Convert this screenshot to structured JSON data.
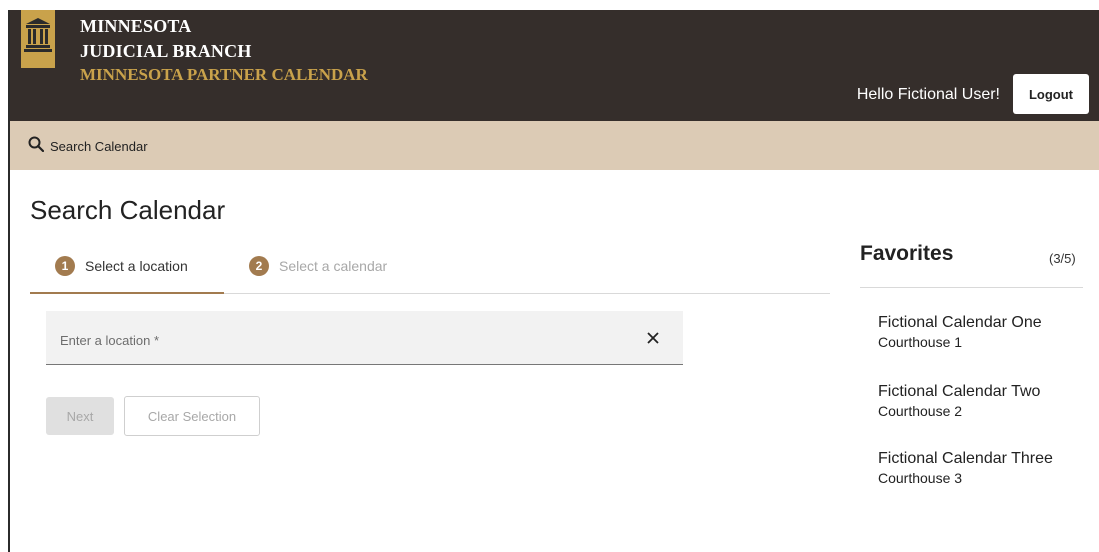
{
  "header": {
    "brand_line1": "MINNESOTA",
    "brand_line2": "JUDICIAL BRANCH",
    "brand_line3": "MINNESOTA PARTNER CALENDAR",
    "greeting": "Hello Fictional User!",
    "logout_label": "Logout",
    "colors": {
      "background": "#352e2b",
      "gold": "#c9a24b"
    }
  },
  "subnav": {
    "icon": "search-icon",
    "label": "Search Calendar",
    "background": "#dccbb5"
  },
  "main": {
    "title": "Search Calendar",
    "steps": [
      {
        "number": "1",
        "label": "Select a location",
        "active": true
      },
      {
        "number": "2",
        "label": "Select a calendar",
        "active": false
      }
    ],
    "location_field": {
      "placeholder": "Enter a location *",
      "value": ""
    },
    "next_label": "Next",
    "clear_selection_label": "Clear Selection",
    "accent": "#a27b4f"
  },
  "favorites": {
    "title": "Favorites",
    "count": "(3/5)",
    "items": [
      {
        "name": "Fictional Calendar One",
        "location": "Courthouse 1"
      },
      {
        "name": "Fictional Calendar Two",
        "location": "Courthouse 2"
      },
      {
        "name": "Fictional Calendar Three",
        "location": "Courthouse 3"
      }
    ]
  }
}
